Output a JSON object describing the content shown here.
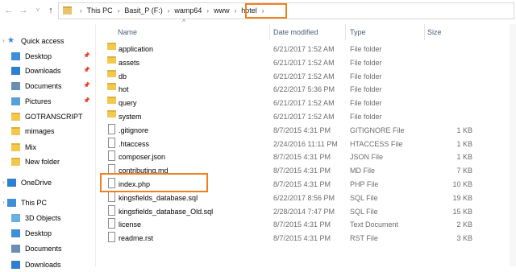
{
  "addressbar": {
    "crumbs": [
      "This PC",
      "Basit_P (F:)",
      "wamp64",
      "www",
      "hotel"
    ]
  },
  "columns": {
    "name": "Name",
    "date": "Date modified",
    "type": "Type",
    "size": "Size"
  },
  "sidebar": {
    "items": [
      {
        "label": "Quick access",
        "icon": "star-icon",
        "pinned": false
      },
      {
        "label": "Desktop",
        "icon": "desktop-icon",
        "pinned": true
      },
      {
        "label": "Downloads",
        "icon": "download-icon",
        "pinned": true
      },
      {
        "label": "Documents",
        "icon": "documents-icon",
        "pinned": true
      },
      {
        "label": "Pictures",
        "icon": "pictures-icon",
        "pinned": true
      },
      {
        "label": "GOTRANSCRIPT",
        "icon": "folder-icon",
        "pinned": false
      },
      {
        "label": "mimages",
        "icon": "folder-icon",
        "pinned": false
      },
      {
        "label": "Mix",
        "icon": "folder-icon",
        "pinned": false
      },
      {
        "label": "New folder",
        "icon": "folder-icon",
        "pinned": false
      },
      {
        "label": "OneDrive",
        "icon": "cloud-icon",
        "pinned": false
      },
      {
        "label": "This PC",
        "icon": "computer-icon",
        "pinned": false
      },
      {
        "label": "3D Objects",
        "icon": "cube-icon",
        "pinned": false
      },
      {
        "label": "Desktop",
        "icon": "desktop-icon",
        "pinned": false
      },
      {
        "label": "Documents",
        "icon": "documents-icon",
        "pinned": false
      },
      {
        "label": "Downloads",
        "icon": "download-icon",
        "pinned": false
      }
    ]
  },
  "files": [
    {
      "name": "application",
      "date": "6/21/2017 1:52 AM",
      "type": "File folder",
      "size": "",
      "kind": "folder"
    },
    {
      "name": "assets",
      "date": "6/21/2017 1:52 AM",
      "type": "File folder",
      "size": "",
      "kind": "folder"
    },
    {
      "name": "db",
      "date": "6/21/2017 1:52 AM",
      "type": "File folder",
      "size": "",
      "kind": "folder"
    },
    {
      "name": "hot",
      "date": "6/22/2017 5:36 PM",
      "type": "File folder",
      "size": "",
      "kind": "folder"
    },
    {
      "name": "query",
      "date": "6/21/2017 1:52 AM",
      "type": "File folder",
      "size": "",
      "kind": "folder"
    },
    {
      "name": "system",
      "date": "6/21/2017 1:52 AM",
      "type": "File folder",
      "size": "",
      "kind": "folder"
    },
    {
      "name": ".gitignore",
      "date": "8/7/2015 4:31 PM",
      "type": "GITIGNORE File",
      "size": "1 KB",
      "kind": "file"
    },
    {
      "name": ".htaccess",
      "date": "2/24/2016 11:11 PM",
      "type": "HTACCESS File",
      "size": "1 KB",
      "kind": "file"
    },
    {
      "name": "composer.json",
      "date": "8/7/2015 4:31 PM",
      "type": "JSON File",
      "size": "1 KB",
      "kind": "file"
    },
    {
      "name": "contributing.md",
      "date": "8/7/2015 4:31 PM",
      "type": "MD File",
      "size": "7 KB",
      "kind": "file"
    },
    {
      "name": "index.php",
      "date": "8/7/2015 4:31 PM",
      "type": "PHP File",
      "size": "10 KB",
      "kind": "file"
    },
    {
      "name": "kingsfields_database.sql",
      "date": "6/22/2017 8:56 PM",
      "type": "SQL File",
      "size": "19 KB",
      "kind": "file"
    },
    {
      "name": "kingsfields_database_Old.sql",
      "date": "2/28/2014 7:47 PM",
      "type": "SQL File",
      "size": "15 KB",
      "kind": "file"
    },
    {
      "name": "license",
      "date": "8/7/2015 4:31 PM",
      "type": "Text Document",
      "size": "2 KB",
      "kind": "file"
    },
    {
      "name": "readme.rst",
      "date": "8/7/2015 4:31 PM",
      "type": "RST File",
      "size": "3 KB",
      "kind": "file"
    }
  ],
  "colors": {
    "highlight": "#f0801f",
    "folder": "#f2c94c",
    "header_text": "#4c607a"
  }
}
